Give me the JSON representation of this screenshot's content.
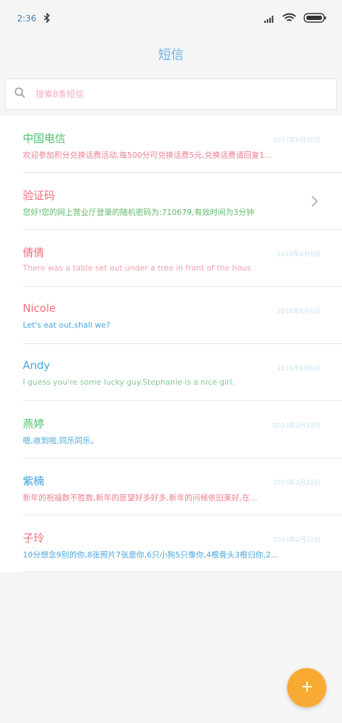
{
  "status_bar": {
    "time": "2:36"
  },
  "header": {
    "title": "短信",
    "title_color": "#6fb2e6",
    "title_accent": "#f59aa5"
  },
  "search": {
    "placeholder": "搜索8条短信"
  },
  "conversations": [
    {
      "name": "中国电信",
      "name_color": "#4cc36b",
      "date": "2017年6月30日",
      "preview": "欢迎参加积分兑换话费活动,每500分可兑换话费5元,兑换话费请回复1...",
      "preview_color": "#ec7f8f"
    },
    {
      "name": "验证码",
      "name_color": "#f06d7d",
      "date": "",
      "preview": "您好!您的网上营业厅登录的随机密码为:710679,有效时间为3分钟",
      "preview_color": "#63b96a"
    },
    {
      "name": "倩倩",
      "name_color": "#f06d7d",
      "date": "2016年6月6日",
      "preview": "There was a table set out under a tree in front of the hous",
      "preview_color": "#f2a0ad"
    },
    {
      "name": "Nicole",
      "name_color": "#f06d7d",
      "date": "2016年6月6日",
      "preview": "Let's eat out,shall we?",
      "preview_color": "#49a6df"
    },
    {
      "name": "Andy",
      "name_color": "#49a6df",
      "date": "2016年6月6日",
      "preview": "I guess you're some lucky guy.Stephanie is a nice girl.",
      "preview_color": "#86c69b"
    },
    {
      "name": "燕婷",
      "name_color": "#4cc36b",
      "date": "2013年2月22日",
      "preview": "嗯,收到啦,同乐同乐。",
      "preview_color": "#49a6df"
    },
    {
      "name": "紫楠",
      "name_color": "#3a9fdc",
      "date": "2013年2月22日",
      "preview": "新年的祝福数不胜数,新年的愿望好多好多,新年的问候依旧美好,在...",
      "preview_color": "#ec7f8f"
    },
    {
      "name": "子玲",
      "name_color": "#f06d7d",
      "date": "2013年2月22日",
      "preview": "10分想念9别的你,8张照片7张是你,6只小狗5只像你,4根骨头3根归你,2...",
      "preview_color": "#49a6df"
    }
  ],
  "fab": {
    "label": "+",
    "color": "#f9aa33"
  }
}
